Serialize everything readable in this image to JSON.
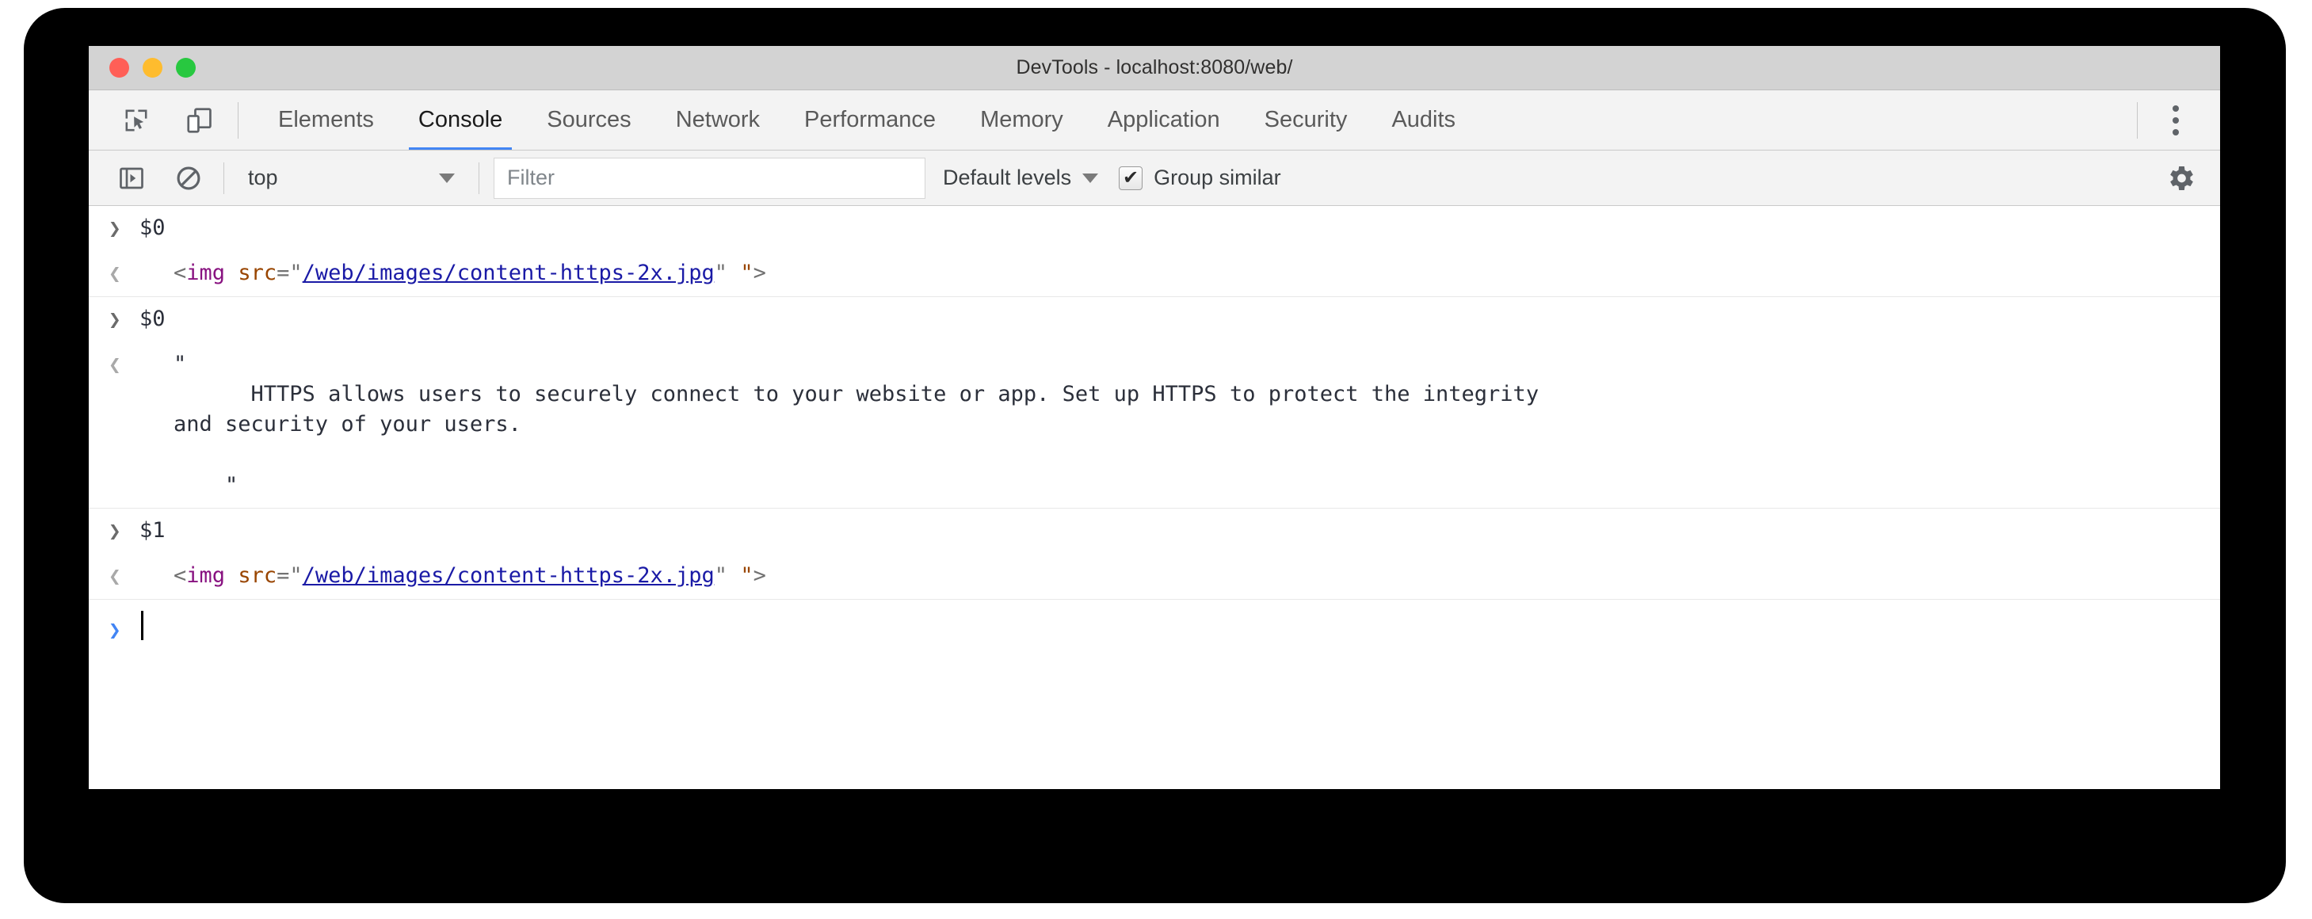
{
  "window": {
    "title": "DevTools - localhost:8080/web/",
    "traffic_lights": {
      "close_color": "#ff5f57",
      "minimize_color": "#febc2e",
      "maximize_color": "#28c840"
    }
  },
  "toolbar": {
    "inspect_icon": "inspect-element-icon",
    "device_icon": "device-toolbar-icon",
    "more_icon": "more-options-icon"
  },
  "tabs": [
    {
      "label": "Elements",
      "active": false
    },
    {
      "label": "Console",
      "active": true
    },
    {
      "label": "Sources",
      "active": false
    },
    {
      "label": "Network",
      "active": false
    },
    {
      "label": "Performance",
      "active": false
    },
    {
      "label": "Memory",
      "active": false
    },
    {
      "label": "Application",
      "active": false
    },
    {
      "label": "Security",
      "active": false
    },
    {
      "label": "Audits",
      "active": false
    }
  ],
  "filterbar": {
    "sidebar_toggle_icon": "console-sidebar-toggle-icon",
    "clear_console_icon": "clear-console-icon",
    "context": "top",
    "context_caret": "▼",
    "filter_value": "",
    "filter_placeholder": "Filter",
    "levels_label": "Default levels",
    "levels_caret": "▼",
    "group_similar_label": "Group similar",
    "group_similar_checked": true,
    "group_similar_check_glyph": "✔",
    "settings_icon": "settings-gear-icon"
  },
  "console": {
    "input_marker": "❯",
    "output_marker": "❮",
    "prompt_marker": "❯",
    "entries": [
      {
        "kind": "input",
        "text": "$0"
      },
      {
        "kind": "output",
        "type": "html",
        "tokens": {
          "open": "<",
          "tag": "img",
          "space": " ",
          "attr": "src",
          "eq": "=",
          "quote_open": "\"",
          "value": "/web/images/content-https-2x.jpg",
          "quote_close": "\"",
          "gap": " ",
          "quote_extra": "\"",
          "close": ">"
        }
      },
      {
        "kind": "input",
        "text": "$0"
      },
      {
        "kind": "output",
        "type": "string",
        "lines": [
          "\"",
          "      HTTPS allows users to securely connect to your website or app. Set up HTTPS to protect the integrity",
          "and security of your users.",
          "",
          "    \""
        ]
      },
      {
        "kind": "input",
        "text": "$1"
      },
      {
        "kind": "output",
        "type": "html",
        "tokens": {
          "open": "<",
          "tag": "img",
          "space": " ",
          "attr": "src",
          "eq": "=",
          "quote_open": "\"",
          "value": "/web/images/content-https-2x.jpg",
          "quote_close": "\"",
          "gap": " ",
          "quote_extra": "\"",
          "close": ">"
        }
      },
      {
        "kind": "prompt",
        "text": ""
      }
    ]
  },
  "colors": {
    "accent": "#4285f4",
    "tag": "#881280",
    "attribute": "#994500",
    "value": "#1a1aa6",
    "punctuation": "#727272",
    "titlebar_bg": "#d3d3d3",
    "toolbar_bg": "#f3f3f3"
  }
}
